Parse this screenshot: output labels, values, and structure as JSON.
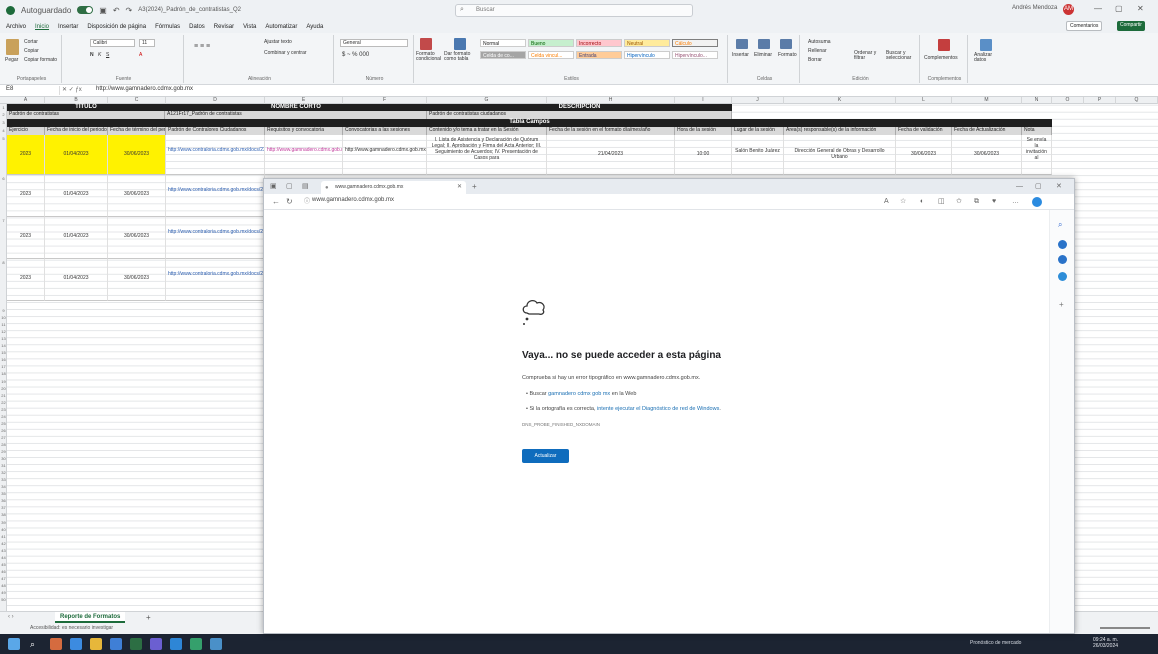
{
  "titlebar": {
    "autosave": "Autoguardado",
    "file": "A3(2024)_Padrón_de_contratistas_Q2",
    "search": "Buscar",
    "user": "Andrés Mendoza",
    "avatar": "AM"
  },
  "menu": [
    "Archivo",
    "Inicio",
    "Insertar",
    "Disposición de página",
    "Fórmulas",
    "Datos",
    "Revisar",
    "Vista",
    "Automatizar",
    "Ayuda"
  ],
  "menu_active": "Inicio",
  "comments": "Comentarios",
  "share": "Compartir",
  "ribbon": {
    "clipboard": {
      "paste": "Pegar",
      "cut": "Cortar",
      "copy": "Copiar",
      "format": "Copiar formato",
      "label": "Portapapeles"
    },
    "font": {
      "name": "Calibri",
      "size": "11",
      "label": "Fuente"
    },
    "align": {
      "wrap": "Ajustar texto",
      "merge": "Combinar y centrar",
      "label": "Alineación"
    },
    "number": {
      "format": "General",
      "label": "Número"
    },
    "styles": {
      "cond": "Formato condicional",
      "table": "Dar formato como tabla",
      "label": "Estilos",
      "cells": [
        "Normal",
        "Bueno",
        "Incorrecto",
        "Neutral",
        "Cálculo",
        "Celda de co...",
        "Celda vincul...",
        "Entrada",
        "Hipervínculo",
        "Hipervínculo..."
      ]
    },
    "cells": {
      "insert": "Insertar",
      "delete": "Eliminar",
      "format": "Formato",
      "label": "Celdas"
    },
    "edit": {
      "autosum": "Autosuma",
      "fill": "Rellenar",
      "clear": "Borrar",
      "sort": "Ordenar y filtrar",
      "find": "Buscar y seleccionar",
      "label": "Edición"
    },
    "addins": {
      "a": "Complementos",
      "label": "Complementos"
    },
    "analyze": {
      "a": "Analizar datos"
    }
  },
  "formula": {
    "cell": "E8",
    "value": "http://www.gamnadero.cdmx.gob.mx"
  },
  "columns": [
    "A",
    "B",
    "C",
    "D",
    "E",
    "F",
    "G",
    "H",
    "I",
    "J",
    "K",
    "L",
    "M",
    "N",
    "O",
    "P",
    "Q"
  ],
  "sheet": {
    "title_label": "TÍTULO",
    "short_label": "NOMBRE CORTO",
    "desc_label": "DESCRIPCIÓN",
    "title_val": "Padrón de contratistas",
    "short_val": "A121Fr17_Padrón de contratistas",
    "desc_val": "Padrón de contratistas ciudadanos",
    "tabla": "Tabla Campos",
    "headers": [
      "Ejercicio",
      "Fecha de inicio del periodo que se informa",
      "Fecha de término del periodo que se informa",
      "Padrón de Contralores Ciudadanos",
      "Requisitos y convocatoria",
      "Convocatorias a las sesiones",
      "Contenido y/o tema a tratar en la Sesión",
      "Fecha de la sesión en el formato día/mes/año",
      "Hora de la sesión",
      "Lugar de la sesión",
      "Área(s) responsable(s) de la información",
      "Fecha de validación",
      "Fecha de Actualización",
      "Nota"
    ],
    "rows": [
      {
        "y": "2023",
        "i": "01/04/2023",
        "t": "30/06/2023",
        "p": "http://www.contraloria.cdmx.gob.mx/docs/2XX021_PADRON.pdf",
        "r": "http://www.gamnadero.cdmx.gob.mx",
        "c": "http://www.gamnadero.cdmx.gob.mx",
        "tema": "I. Lista de Asistencia y Declaración de Quórum Legal; II. Aprobación y Firma del Acta Anterior; III. Seguimiento de Acuerdos; IV. Presentación de Casos para",
        "f": "21/04/2023",
        "h": "10:00",
        "l": "Salón Benito Juárez",
        "a": "Dirección General de Obras y Desarrollo Urbano",
        "v": "30/06/2023",
        "u": "30/06/2023",
        "n": "Se envía la invitación al"
      },
      {
        "y": "2023",
        "i": "01/04/2023",
        "t": "30/06/2023",
        "p": "http://www.contraloria.cdmx.gob.mx/docs/2XX021_PADRON.pdf"
      },
      {
        "y": "2023",
        "i": "01/04/2023",
        "t": "30/06/2023",
        "p": "http://www.contraloria.cdmx.gob.mx/docs/2XX021_PADRON.pdf"
      },
      {
        "y": "2023",
        "i": "01/04/2023",
        "t": "30/06/2023",
        "p": "http://www.contraloria.cdmx.gob.mx/docs/2XX021_PADRON.pdf"
      }
    ]
  },
  "sheet_tab": "Reporte de Formatos",
  "status": "Accesibilidad: es necesario investigar",
  "browser": {
    "tab": "www.gamnadero.cdmx.gob.mx",
    "url": "www.gamnadero.cdmx.gob.mx",
    "err_title": "Vaya... no se puede acceder a esta página",
    "err_sub": "Comprueba si hay un error tipográfico en www.gamnadero.cdmx.gob.mx.",
    "b1a": "Buscar ",
    "b1b": "gamnadero cdmx gob mx",
    "b1c": " en la Web",
    "b2a": "Si la ortografía es correcta, ",
    "b2b": "intente ejecutar el Diagnóstico de red de Windows",
    "b2c": ".",
    "code": "DNS_PROBE_FINISHED_NXDOMAIN",
    "retry": "Actualizar"
  },
  "taskbar": {
    "tray": "Pronóstico de mercado",
    "time": "09:24 a. m.",
    "date": "26/03/2024"
  }
}
